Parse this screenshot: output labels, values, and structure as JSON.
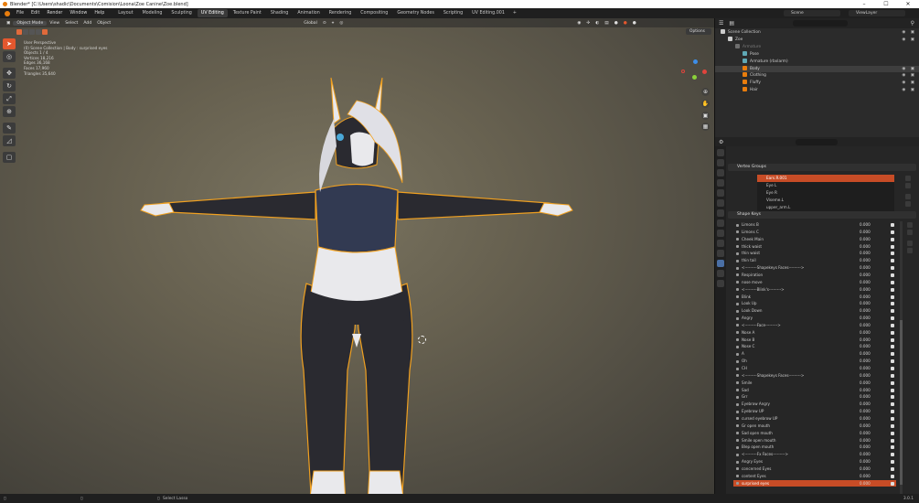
{
  "titlebar": {
    "title": "Blender* [C:\\Users\\shadic\\Documents\\Comision\\Loona\\Zoe Canine\\Zoe.blend]",
    "minimize": "–",
    "maximize": "☐",
    "close": "✕"
  },
  "menubar": {
    "menus": [
      "File",
      "Edit",
      "Render",
      "Window",
      "Help"
    ],
    "workspaces": [
      "Layout",
      "Modeling",
      "Sculpting",
      "UV Editing",
      "Texture Paint",
      "Shading",
      "Animation",
      "Rendering",
      "Compositing",
      "Geometry Nodes",
      "Scripting",
      "UV Editing.001"
    ],
    "active_workspace": "UV Editing",
    "add_tab": "+",
    "scene_label": "Scene",
    "viewlayer_label": "ViewLayer"
  },
  "viewport": {
    "mode": "Object Mode",
    "menus": [
      "View",
      "Select",
      "Add",
      "Object"
    ],
    "orientation": "Global",
    "options_label": "Options",
    "info_lines": [
      "User Perspective",
      "(0) Scene Collection | Body : surprised eyes",
      "Objects  1 / 4",
      "Vertices  18,216",
      "Edges  36,168",
      "Faces  17,960",
      "Triangles  35,640"
    ]
  },
  "outliner": {
    "rows": [
      {
        "label": "Scene Collection",
        "indent": 0,
        "icon": "collection"
      },
      {
        "label": "Zoe",
        "indent": 1,
        "icon": "collection"
      },
      {
        "label": "Armature",
        "indent": 2,
        "icon": "armature",
        "dim": true
      },
      {
        "label": "Pose",
        "indent": 3,
        "icon": "pose"
      },
      {
        "label": "Armature (rbxlarm)",
        "indent": 3,
        "icon": "armature-data"
      },
      {
        "label": "Body",
        "indent": 3,
        "icon": "mesh",
        "selected": true
      },
      {
        "label": "Clothing",
        "indent": 3,
        "icon": "mesh"
      },
      {
        "label": "Fluffy",
        "indent": 3,
        "icon": "mesh"
      },
      {
        "label": "Hair",
        "indent": 3,
        "icon": "mesh"
      }
    ]
  },
  "properties": {
    "vertex_groups_title": "Vertex Groups",
    "vertex_groups": [
      "Ears.R.001",
      "Eye L",
      "Eye R",
      "Viseme.L",
      "upper_arm.L"
    ],
    "vertex_groups_selected": 0,
    "shape_keys_title": "Shape Keys",
    "shape_keys": [
      {
        "name": "Limons B",
        "value": "0.000"
      },
      {
        "name": "Limons C",
        "value": "0.000"
      },
      {
        "name": "Cheek Main",
        "value": "0.000"
      },
      {
        "name": "thick waist",
        "value": "0.000"
      },
      {
        "name": "thin waist",
        "value": "0.000"
      },
      {
        "name": "thin tail",
        "value": "0.000"
      },
      {
        "name": "<---------Shapekeys Faces--------->",
        "value": "0.000"
      },
      {
        "name": "Respiration",
        "value": "0.000"
      },
      {
        "name": "nose move",
        "value": "0.000"
      },
      {
        "name": "<---------Blink's--------->",
        "value": "0.000"
      },
      {
        "name": "Blink",
        "value": "0.000"
      },
      {
        "name": "Look Up",
        "value": "0.000"
      },
      {
        "name": "Look Down",
        "value": "0.000"
      },
      {
        "name": "Angry",
        "value": "0.000"
      },
      {
        "name": "<---------Face--------->",
        "value": "0.000"
      },
      {
        "name": "Nose A",
        "value": "0.000"
      },
      {
        "name": "Nose B",
        "value": "0.000"
      },
      {
        "name": "Nose C",
        "value": "0.000"
      },
      {
        "name": "A",
        "value": "0.000"
      },
      {
        "name": "Oh",
        "value": "0.000"
      },
      {
        "name": "CH",
        "value": "0.000"
      },
      {
        "name": "<---------Shapekeys Faces--------->",
        "value": "0.000"
      },
      {
        "name": "Smile",
        "value": "0.000"
      },
      {
        "name": "Sad",
        "value": "0.000"
      },
      {
        "name": "Grr",
        "value": "0.000"
      },
      {
        "name": "Eyebrow Angry",
        "value": "0.000"
      },
      {
        "name": "Eyebrow UP",
        "value": "0.000"
      },
      {
        "name": "cursed eyebrow UP",
        "value": "0.000"
      },
      {
        "name": "Gr open mouth",
        "value": "0.000"
      },
      {
        "name": "Sad open mouth",
        "value": "0.000"
      },
      {
        "name": "Smile open mouth",
        "value": "0.000"
      },
      {
        "name": "Blep open mouth",
        "value": "0.000"
      },
      {
        "name": "<---------Fx Faces--------->",
        "value": "0.000"
      },
      {
        "name": "Angry Eyes",
        "value": "0.000"
      },
      {
        "name": "concerned Eyes",
        "value": "0.000"
      },
      {
        "name": "content Eyes",
        "value": "0.000"
      },
      {
        "name": "surprised eyes",
        "value": "0.000",
        "selected": true
      }
    ]
  },
  "statusbar": {
    "left": "",
    "middle": "Select Lasso",
    "version": "3.0.1"
  },
  "colors": {
    "accent": "#e4572e",
    "selection": "#c74c26",
    "outline": "#f0a020",
    "fur_light": "#e9e9ec",
    "fur_dark": "#2a2a30",
    "clothing_top": "#323a52"
  }
}
